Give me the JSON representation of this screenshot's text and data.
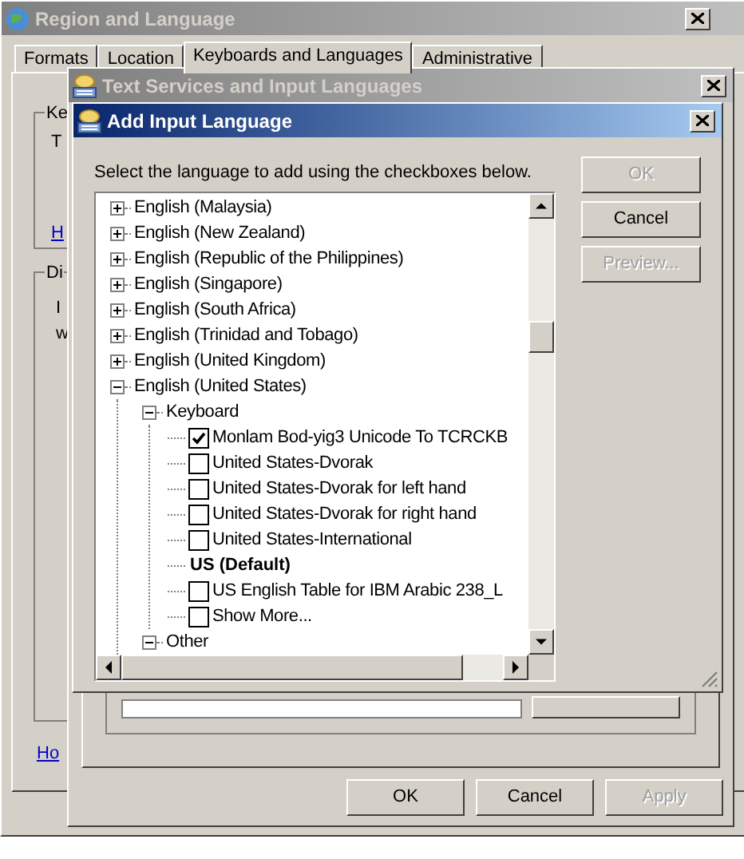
{
  "region_window": {
    "title": "Region and Language",
    "tabs": [
      {
        "label": "Formats",
        "selected": false
      },
      {
        "label": "Location",
        "selected": false
      },
      {
        "label": "Keyboards and Languages",
        "selected": true
      },
      {
        "label": "Administrative",
        "selected": false
      }
    ],
    "group_1": {
      "label": "Ke",
      "text": "T",
      "link": "H"
    },
    "group_2": {
      "label": "Di",
      "text_lines": [
        "I",
        "w"
      ]
    },
    "link": "Ho"
  },
  "text_services_window": {
    "title": "Text Services and Input Languages",
    "buttons": [
      {
        "label": "OK",
        "disabled": false
      },
      {
        "label": "Cancel",
        "disabled": false
      },
      {
        "label": "Apply",
        "disabled": true
      }
    ]
  },
  "add_language_dialog": {
    "title": "Add Input Language",
    "instruction": "Select the language to add using the checkboxes below.",
    "tree": [
      {
        "kind": "group",
        "label": "English (Malaysia)",
        "expanded": false
      },
      {
        "kind": "group",
        "label": "English (New Zealand)",
        "expanded": false
      },
      {
        "kind": "group",
        "label": "English (Republic of the Philippines)",
        "expanded": false
      },
      {
        "kind": "group",
        "label": "English (Singapore)",
        "expanded": false
      },
      {
        "kind": "group",
        "label": "English (South Africa)",
        "expanded": false
      },
      {
        "kind": "group",
        "label": "English (Trinidad and Tobago)",
        "expanded": false
      },
      {
        "kind": "group",
        "label": "English (United Kingdom)",
        "expanded": false
      },
      {
        "kind": "group",
        "label": "English (United States)",
        "expanded": true,
        "children": [
          {
            "kind": "group",
            "label": "Keyboard",
            "expanded": true,
            "children": [
              {
                "kind": "checkbox",
                "label": "Monlam Bod-yig3 Unicode To TCRCKB",
                "checked": true
              },
              {
                "kind": "checkbox",
                "label": "United States-Dvorak",
                "checked": false
              },
              {
                "kind": "checkbox",
                "label": "United States-Dvorak for left hand",
                "checked": false
              },
              {
                "kind": "checkbox",
                "label": "United States-Dvorak for right hand",
                "checked": false
              },
              {
                "kind": "checkbox",
                "label": "United States-International",
                "checked": false
              },
              {
                "kind": "default",
                "label": "US (Default)"
              },
              {
                "kind": "checkbox",
                "label": "US English Table for IBM Arabic 238_L",
                "checked": false
              },
              {
                "kind": "checkbox",
                "label": "Show More...",
                "checked": false
              }
            ]
          },
          {
            "kind": "group",
            "label": "Other",
            "expanded": true
          }
        ]
      }
    ],
    "buttons": [
      {
        "label": "OK",
        "disabled": true
      },
      {
        "label": "Cancel",
        "disabled": false
      },
      {
        "label": "Preview...",
        "disabled": true
      }
    ]
  }
}
